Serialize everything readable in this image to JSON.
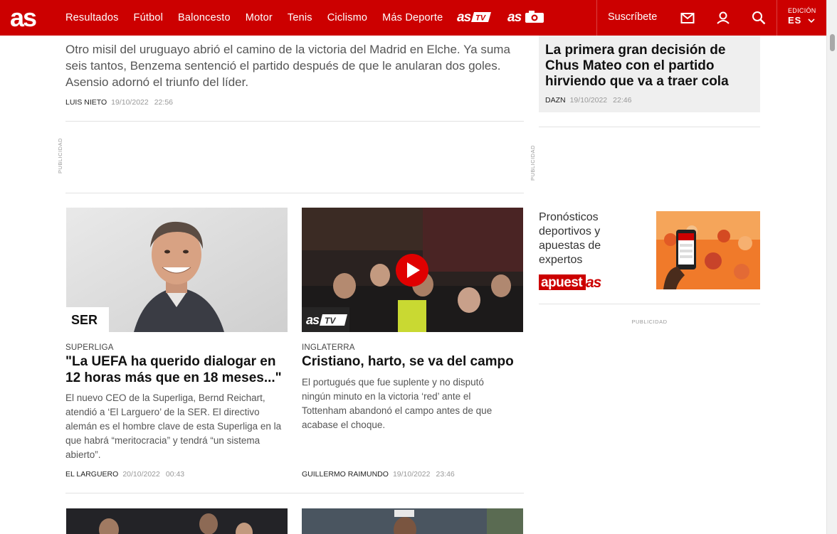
{
  "header": {
    "logo_text": "as",
    "nav": [
      "Resultados",
      "Fútbol",
      "Baloncesto",
      "Motor",
      "Tenis",
      "Ciclismo",
      "Más Deporte"
    ],
    "subscribe_label": "Suscríbete",
    "edition_label": "EDICIÓN",
    "edition_value": "ES",
    "brand_color": "#cc0000"
  },
  "lead": {
    "summary": "Otro misil del uruguayo abrió el camino de la victoria del Madrid en Elche. Ya suma seis tantos, Benzema sentenció el partido después de que le anularan dos goles. Asensio adornó el triunfo del líder.",
    "author": "LUIS NIETO",
    "date": "19/10/2022",
    "time": "22:56"
  },
  "ads": {
    "label": "PUBLICIDAD"
  },
  "cards": [
    {
      "badge": "SER",
      "kicker": "SUPERLIGA",
      "headline": "\"La UEFA ha querido dialogar en 12 horas más que en 18 meses...\"",
      "summary": "El nuevo CEO de la Superliga, Bernd Reichart, atendió a ‘El Larguero’ de la SER. El directivo alemán es el hombre clave de esta Superliga en la que habrá “meritocracia” y tendrá “un sistema abierto”.",
      "author": "EL LARGUERO",
      "date": "20/10/2022",
      "time": "00:43"
    },
    {
      "badge": "astv",
      "kicker": "INGLATERRA",
      "headline": "Cristiano, harto, se va del campo",
      "summary": "El portugués que fue suplente y no disputó ningún minuto en la victoria ‘red’ ante el Tottenham abandonó el campo antes de que acabase el choque.",
      "author": "GUILLERMO RAIMUNDO",
      "date": "19/10/2022",
      "time": "23:46"
    }
  ],
  "sidebar": {
    "top_story": {
      "headline": "La primera gran decisión de Chus Mateo con el partido hirviendo que va a traer cola",
      "author": "DAZN",
      "date": "19/10/2022",
      "time": "22:46"
    },
    "promo": {
      "text": "Pronósticos deportivos y apuestas de expertos",
      "logo_text": "apuestas"
    }
  }
}
